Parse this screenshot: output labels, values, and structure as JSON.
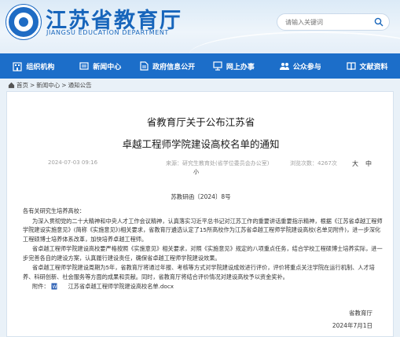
{
  "header": {
    "title": "江苏省教育厅",
    "subtitle": "JIANGSU EDUCATION DEPARTMENT",
    "search_placeholder": "请输入关键词"
  },
  "nav": [
    {
      "label": "组织机构",
      "icon": "building-icon"
    },
    {
      "label": "新闻中心",
      "icon": "newspaper-icon"
    },
    {
      "label": "政府信息公开",
      "icon": "document-icon"
    },
    {
      "label": "网上办事",
      "icon": "computer-icon"
    },
    {
      "label": "公众参与",
      "icon": "people-icon"
    },
    {
      "label": "文献资料",
      "icon": "book-icon"
    }
  ],
  "breadcrumb": {
    "home": "首页",
    "sep": ">",
    "level1": "新闻中心",
    "level2": "通知公告"
  },
  "article": {
    "title_line1": "省教育厅关于公布江苏省",
    "title_line2": "卓越工程师学院建设高校名单的通知",
    "date": "2024-07-03 09:16",
    "source": "来源：研究生教育处(省学位委员会办公室)",
    "views": "浏览次数：4267次",
    "font_size_label_big": "大",
    "font_size_label_mid": "中",
    "font_size_label_small": "小",
    "doc_no": "苏教研函〔2024〕8号",
    "salutation": "各有关研究生培养高校：",
    "para1": "为深入贯彻党的二十大精神和中央人才工作会议精神，认真落实习近平总书记对江苏工作的重要讲话重要指示精神，根据《江苏省卓越工程师学院建设实施意见》(简称《实施意见》)相关要求，省教育厅遴选认定了15所高校作为江苏省卓越工程师学院建设高校(名单见附件)，进一步深化工程硕博士培养体系改革，加快培养卓越工程师。",
    "para2": "省卓越工程师学院建设高校要严格按照《实施意见》相关要求，对照《实施意见》规定的八项重点任务，结合学校工程硕博士培养实际，进一步完善各自的建设方案，认真履行建设责任，确保省卓越工程师学院建设效果。",
    "para3": "省卓越工程师学院建设周期为5年，省教育厅将通过年报、考核等方式对学院建设成效进行评价，评价将重点关注学院在运行机制、人才培养、科研创新、社会服务等方面的成果和贡献。同时，省教育厅将结合评价情况对建设高校予以资金奖补。",
    "attachment_label": "附件：",
    "attachment_name": "江苏省卓越工程师学院建设高校名单.docx",
    "signature": "省教育厅",
    "sign_date": "2024年7月1日"
  },
  "colors": {
    "brand_blue": "#1765bb",
    "nav_blue": "#1c6ec9"
  }
}
